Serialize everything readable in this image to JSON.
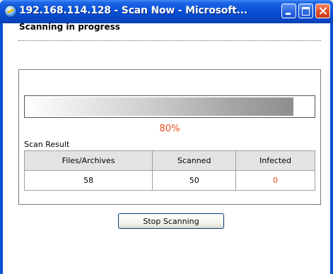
{
  "window": {
    "title": "192.168.114.128 - Scan Now - Microsoft...",
    "controls": [
      "minimize",
      "maximize",
      "close"
    ]
  },
  "page": {
    "heading": "Scanning in progress"
  },
  "progress": {
    "fraction": 0.93,
    "percent_label": "80%"
  },
  "scan_result": {
    "label": "Scan Result",
    "columns": [
      "Files/Archives",
      "Scanned",
      "Infected"
    ],
    "row": [
      "58",
      "50",
      "0"
    ]
  },
  "actions": {
    "stop_label": "Stop Scanning"
  },
  "colors": {
    "accent": "#e84a1a",
    "titlebar": "#0a52d8",
    "header_bg": "#e3e3e3"
  },
  "icons": {
    "window": "ie-globe-icon"
  }
}
